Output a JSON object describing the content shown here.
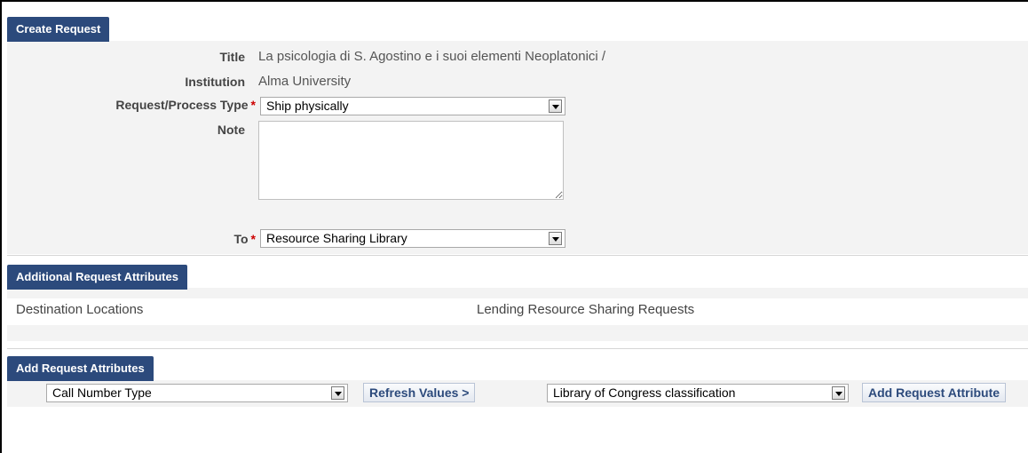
{
  "create_request": {
    "header": "Create Request",
    "title_label": "Title",
    "title_value": "La psicologia di S. Agostino e i suoi elementi Neoplatonici /",
    "institution_label": "Institution",
    "institution_value": "Alma University",
    "request_type_label": "Request/Process Type",
    "request_type_value": "Ship physically",
    "note_label": "Note",
    "note_value": "",
    "to_label": "To",
    "to_value": "Resource Sharing Library",
    "required_mark": "*"
  },
  "additional_attributes": {
    "header": "Additional Request Attributes",
    "col1": "Destination Locations",
    "col2": "Lending Resource Sharing Requests"
  },
  "add_attributes": {
    "header": "Add Request Attributes",
    "attribute_type_value": "Call Number Type",
    "refresh_label": "Refresh Values >",
    "attribute_value_value": "Library of Congress classification",
    "add_label": "Add Request Attribute"
  },
  "colors": {
    "header_bg": "#2c4a7c",
    "panel_bg": "#f3f3f3",
    "required": "#cc0000"
  }
}
